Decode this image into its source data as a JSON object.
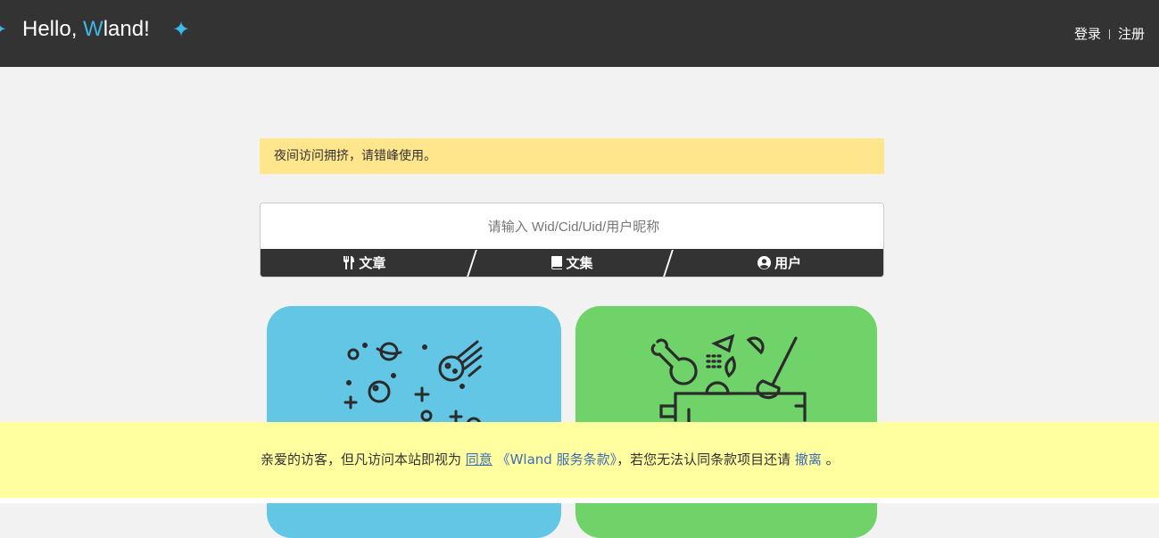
{
  "header": {
    "brand_prefix": "Hello, ",
    "brand_accent": "W",
    "brand_suffix": "land!",
    "login": "登录",
    "register": "注册"
  },
  "notice": {
    "text": "夜间访问拥挤，请错峰使用。"
  },
  "search": {
    "placeholder": "请输入 Wid/Cid/Uid/用户昵称",
    "tabs": [
      {
        "label": "文章",
        "icon": "utensils-icon"
      },
      {
        "label": "文集",
        "icon": "book-icon"
      },
      {
        "label": "用户",
        "icon": "user-circle-icon"
      }
    ]
  },
  "cards": [
    {
      "color": "#62c6e4",
      "icon": "space-comet-icon"
    },
    {
      "color": "#70d36a",
      "icon": "cooking-pot-icon"
    }
  ],
  "cookie": {
    "prefix": "亲爱的访客，但凡访问本站即视为 ",
    "agree": "同意",
    "terms": "《Wland 服务条款》",
    "middle": "，若您无法认同条款项目还请 ",
    "leave": "撤离",
    "suffix": " 。"
  },
  "colors": {
    "header_bg": "#333333",
    "accent": "#3db8e8",
    "notice_bg": "#ffe68c",
    "cookie_bg": "#ffffa0",
    "link": "#3c6cb4"
  }
}
